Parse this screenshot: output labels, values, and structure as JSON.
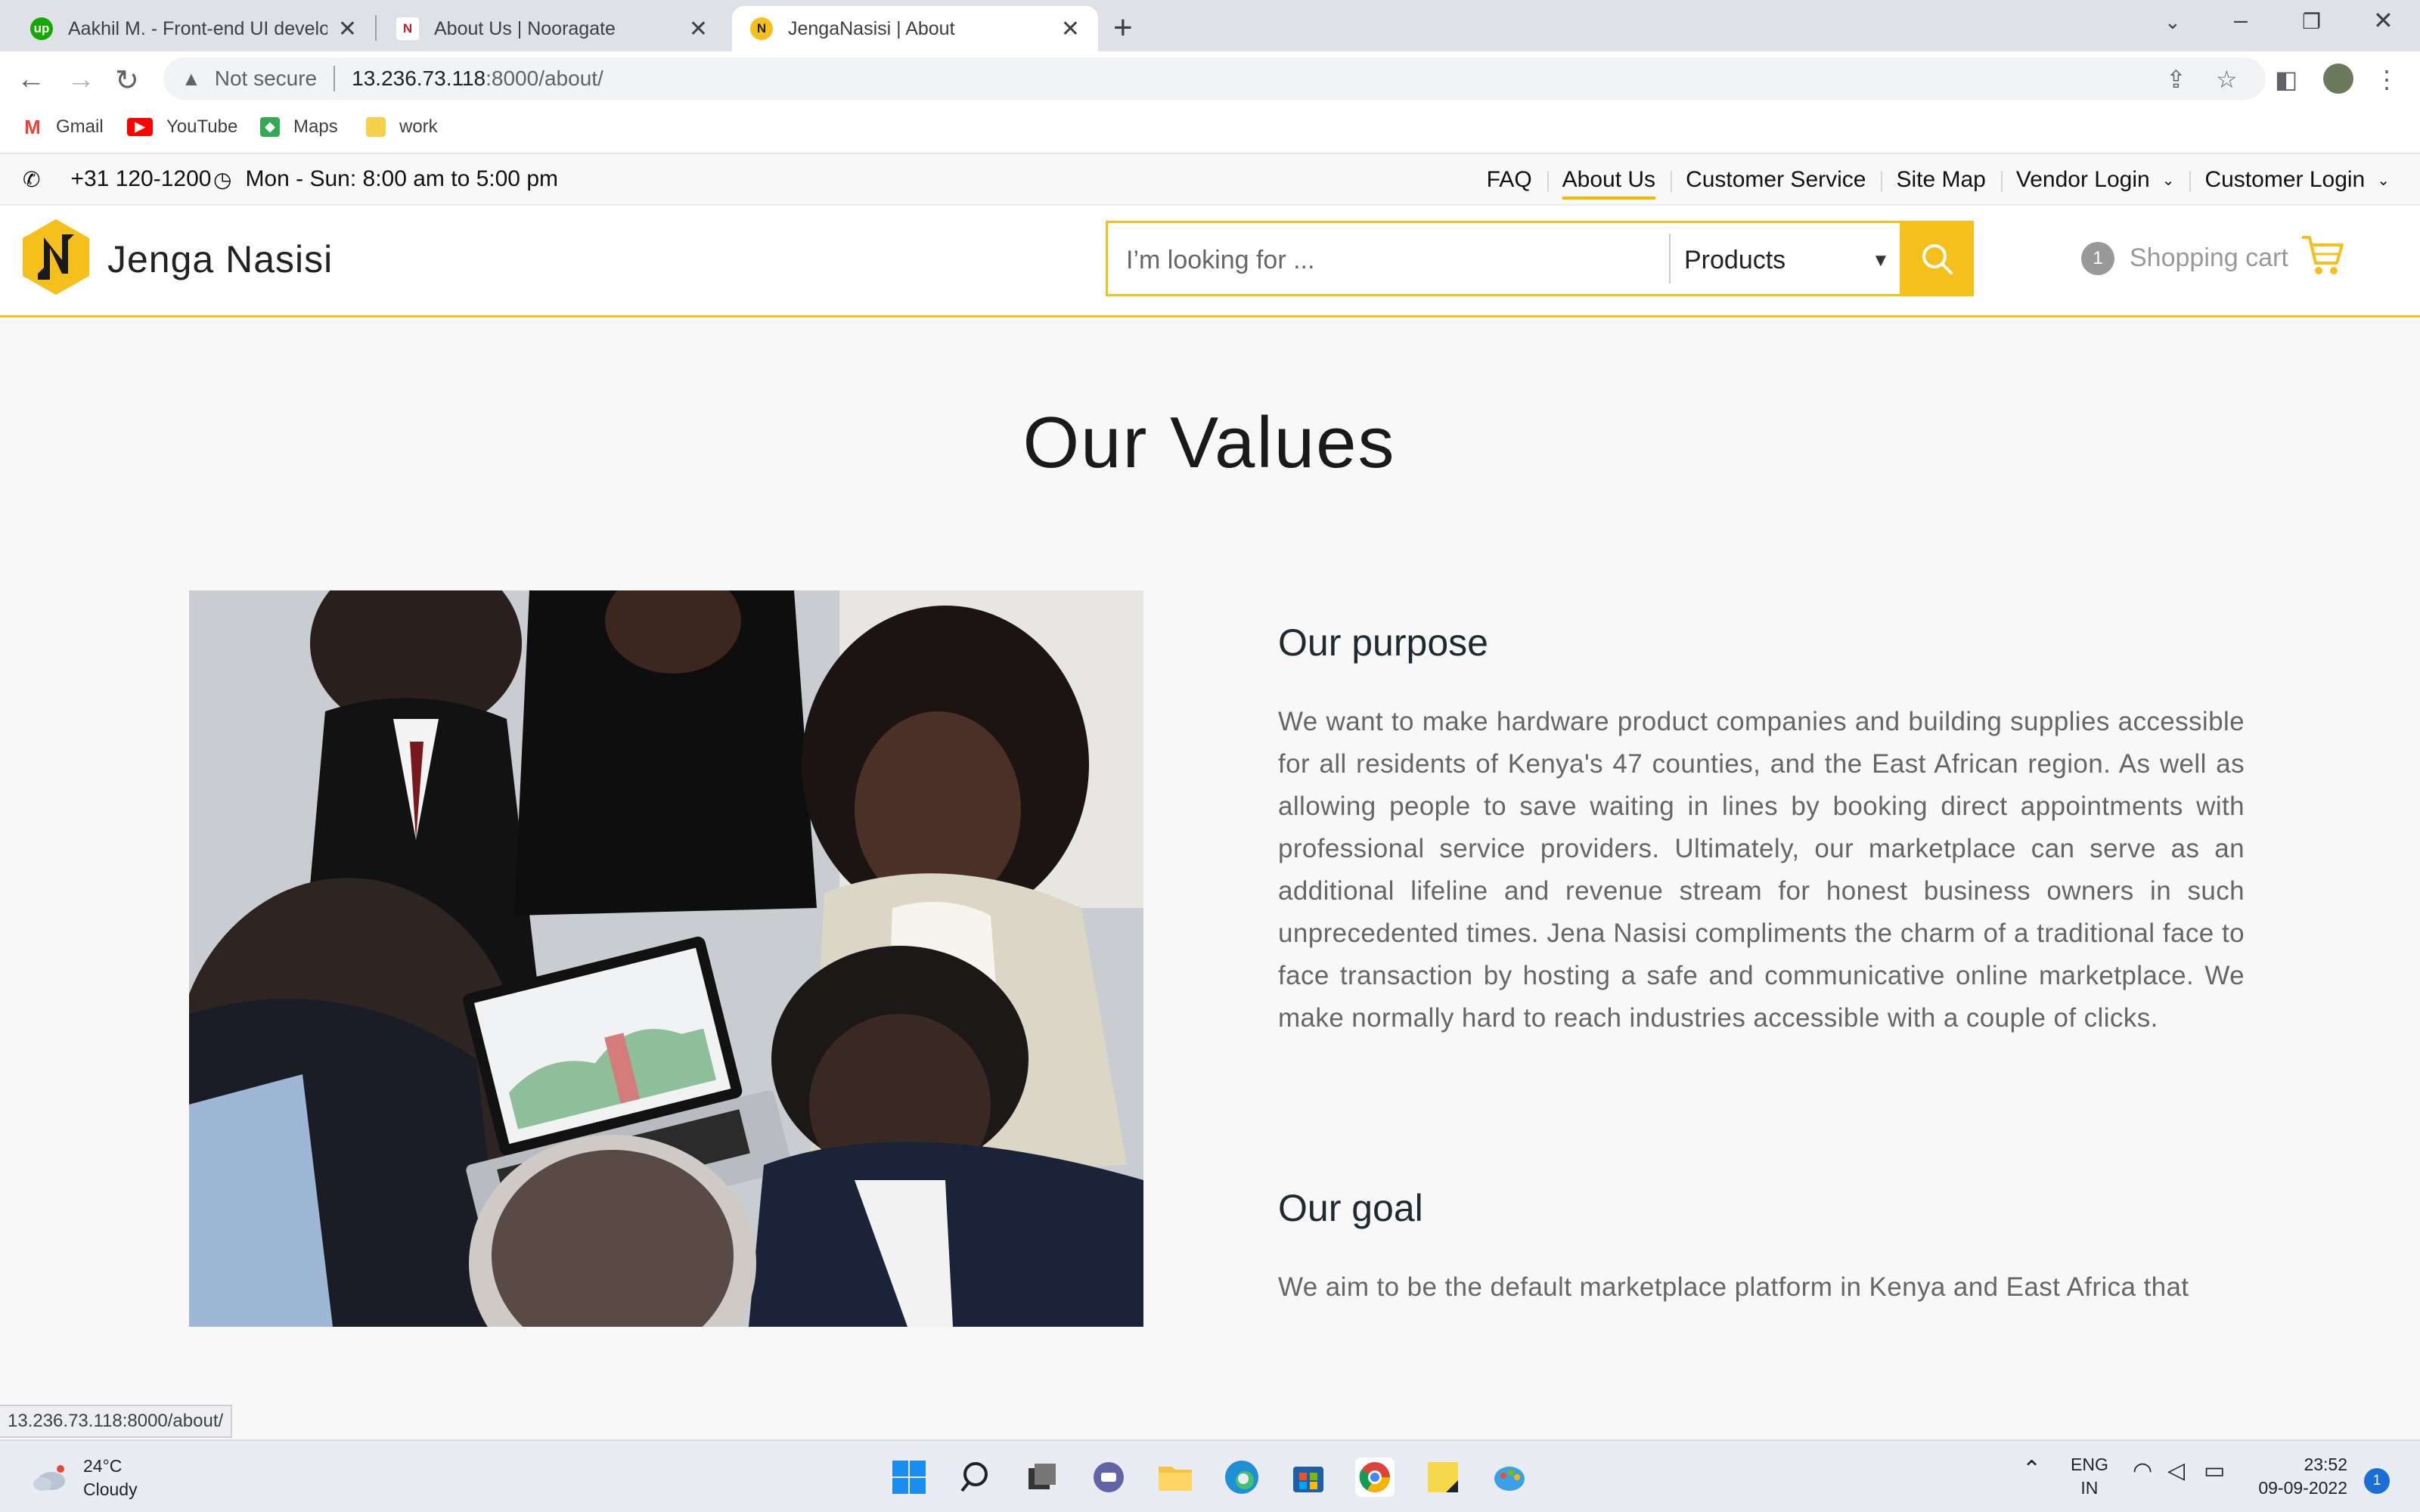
{
  "browser": {
    "tabs": [
      {
        "title": "Aakhil M. - Front-end UI develop",
        "favicon": "upwork-icon"
      },
      {
        "title": "About Us | Nooragate",
        "favicon": "nooragate-icon"
      },
      {
        "title": "JengaNasisi | About",
        "favicon": "jenganasisi-icon"
      }
    ],
    "omnibox": {
      "security": "Not secure",
      "host": "13.236.73.118",
      "path": ":8000/about/"
    },
    "bookmarks": [
      {
        "label": "Gmail",
        "color": "#ea4335"
      },
      {
        "label": "YouTube",
        "color": "#ff0000"
      },
      {
        "label": "Maps",
        "color": "#34a853"
      },
      {
        "label": "work",
        "color": "#f6d14b"
      }
    ],
    "status_url": "13.236.73.118:8000/about/"
  },
  "site": {
    "phone": "+31 120-1200",
    "hours": "Mon - Sun: 8:00 am to 5:00 pm",
    "top_links": {
      "faq": "FAQ",
      "about": "About Us",
      "service": "Customer Service",
      "sitemap": "Site Map",
      "vendor": "Vendor Login",
      "customer": "Customer Login"
    },
    "brand": "Jenga Nasisi",
    "search": {
      "placeholder": "I’m looking for ...",
      "category": "Products"
    },
    "cart": {
      "count": "1",
      "label": "Shopping cart"
    },
    "accent_color": "#f5c01c"
  },
  "content": {
    "heading": "Our Values",
    "purpose": {
      "title": "Our purpose",
      "text": "We want to make hardware product companies and building supplies accessible for all residents of Kenya's 47 counties, and the East African region. As well as allowing people to save waiting in lines by booking direct appointments with professional service providers. Ultimately, our marketplace can serve as an additional lifeline and revenue stream for honest business owners in such unprecedented times. Jena Nasisi compliments the charm of a traditional face to face transaction by hosting a safe and communicative online marketplace. We make normally hard to reach industries accessible with a couple of clicks."
    },
    "goal": {
      "title": "Our goal",
      "text": "We aim to be the default marketplace platform in Kenya and East Africa that"
    }
  },
  "taskbar": {
    "weather": {
      "temp": "24°C",
      "condition": "Cloudy"
    },
    "lang": {
      "line1": "ENG",
      "line2": "IN"
    },
    "time": "23:52",
    "date": "09-09-2022",
    "notifications": "1"
  }
}
